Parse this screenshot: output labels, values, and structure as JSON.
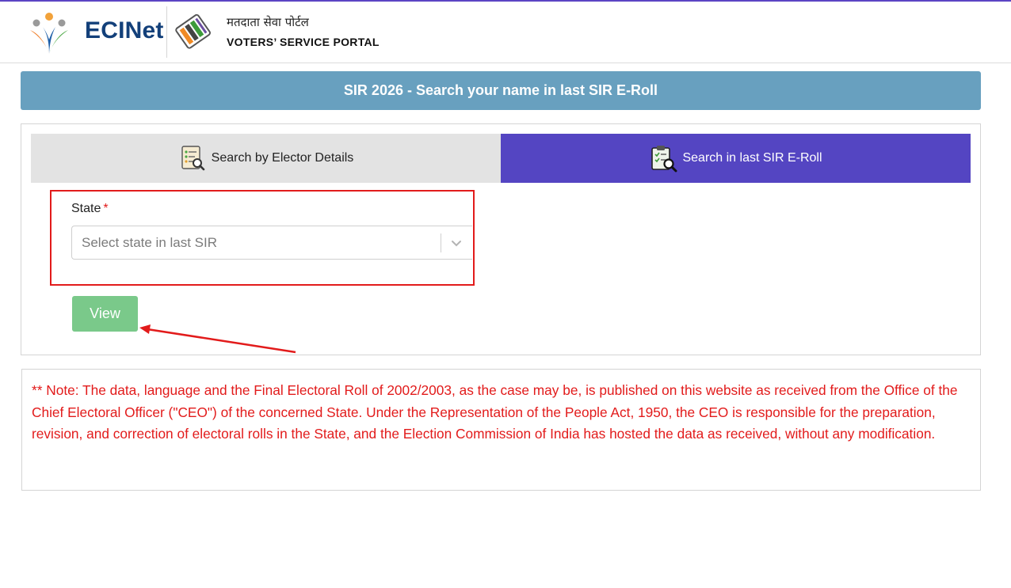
{
  "header": {
    "logo_text": "ECINet",
    "portal_hindi": "मतदाता सेवा पोर्टल",
    "portal_english": "VOTERS’ SERVICE PORTAL"
  },
  "banner": {
    "title": "SIR 2026 - Search your name in last SIR E-Roll"
  },
  "tabs": [
    {
      "label": "Search by Elector Details",
      "icon": "document-search-icon",
      "active": false
    },
    {
      "label": "Search in last SIR E-Roll",
      "icon": "clipboard-search-icon",
      "active": true
    }
  ],
  "form": {
    "state_label": "State",
    "required_mark": "*",
    "state_placeholder": "Select state in last SIR",
    "view_button": "View"
  },
  "note": {
    "text": "** Note: The data, language and the Final Electoral Roll of 2002/2003, as the case may be, is published on this website as received from the Office of the Chief Electoral Officer (\"CEO\") of the concerned State. Under the Representation of the People Act, 1950, the CEO is responsible for the preparation, revision, and correction of electoral rolls in the State, and the Election Commission of India has hosted the data as received, without any modification."
  },
  "colors": {
    "banner": "#68a0bf",
    "active_tab": "#5445c2",
    "view_button": "#7ac98a",
    "note_text": "#e21b1b",
    "annotation": "#e21b1b"
  }
}
